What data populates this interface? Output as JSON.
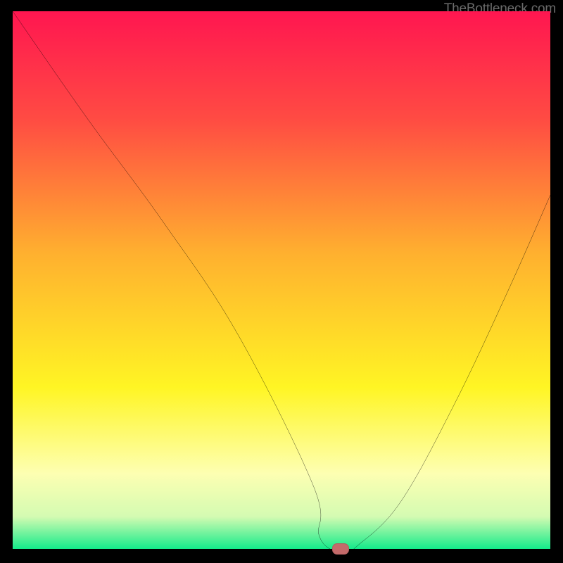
{
  "attribution": "TheBottleneck.com",
  "chart_data": {
    "type": "line",
    "title": "",
    "xlabel": "",
    "ylabel": "",
    "xlim": [
      0,
      100
    ],
    "ylim": [
      0,
      100
    ],
    "grid": false,
    "legend": false,
    "series": [
      {
        "name": "bottleneck-curve",
        "color": "#000000",
        "x": [
          0,
          14,
          28,
          42,
          56,
          57,
          60,
          62,
          64,
          72,
          82,
          92,
          100
        ],
        "values": [
          100,
          80,
          61,
          40,
          12,
          3,
          0,
          0,
          1,
          9,
          27,
          48,
          66
        ]
      }
    ],
    "annotations": [
      {
        "name": "optimal-marker",
        "x": 61,
        "y": 0.5,
        "color": "#c46a6a"
      }
    ],
    "background": {
      "type": "vertical-gradient",
      "stops": [
        {
          "pct": 0,
          "color": "#ff1650"
        },
        {
          "pct": 20,
          "color": "#ff4b43"
        },
        {
          "pct": 45,
          "color": "#ffb02f"
        },
        {
          "pct": 70,
          "color": "#fff524"
        },
        {
          "pct": 86,
          "color": "#fdffb2"
        },
        {
          "pct": 94,
          "color": "#d4fbb2"
        },
        {
          "pct": 100,
          "color": "#14eb8a"
        }
      ]
    }
  }
}
